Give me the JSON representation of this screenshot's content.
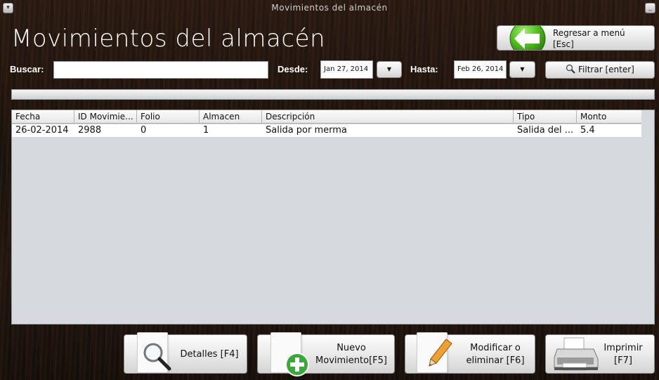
{
  "window": {
    "title": "Movimientos del almacén"
  },
  "page": {
    "heading": "Movimientos del almacén"
  },
  "back_button": {
    "label_line1": "Regresar a menú",
    "label_line2": "[Esc]"
  },
  "search": {
    "label": "Buscar:",
    "value": ""
  },
  "date_from": {
    "label": "Desde:",
    "value": "Jan 27, 2014"
  },
  "date_to": {
    "label": "Hasta:",
    "value": "Feb 26, 2014"
  },
  "filter_button": {
    "label": "Filtrar [enter]"
  },
  "table": {
    "columns": [
      "Fecha",
      "ID Movimie...",
      "Folio",
      "Almacen",
      "Descripción",
      "Tipo",
      "Monto"
    ],
    "rows": [
      [
        "26-02-2014",
        "2988",
        "0",
        "1",
        "Salida por merma",
        "Salida del ...",
        "5.4"
      ]
    ]
  },
  "actions": {
    "details": {
      "label": "Detalles [F4]"
    },
    "new": {
      "label_line1": "Nuevo",
      "label_line2": "Movimiento[F5]"
    },
    "modify": {
      "label_line1": "Modificar o",
      "label_line2": "eliminar [F6]"
    },
    "print": {
      "label_line1": "Imprimir",
      "label_line2": "[F7]"
    }
  },
  "icons": {
    "back": "arrow-left-icon",
    "filter": "magnifier-icon",
    "details": "magnifier-icon",
    "new": "plus-icon",
    "modify": "pencil-icon",
    "print": "printer-icon"
  },
  "colors": {
    "back_arrow": "#4db81e",
    "plus": "#3aa83a"
  }
}
